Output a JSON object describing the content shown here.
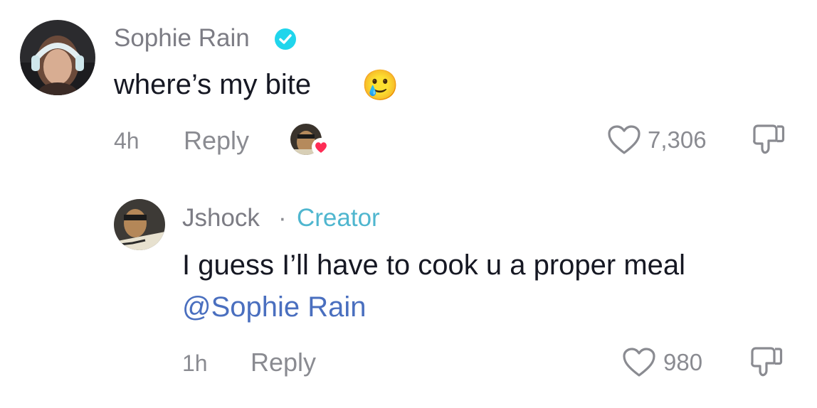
{
  "comments": [
    {
      "username": "Sophie Rain",
      "text": "where’s my bite",
      "emoji": "🥲",
      "time": "4h",
      "reply_label": "Reply",
      "like_count": "7,306"
    }
  ],
  "reply": {
    "username": "Jshock",
    "separator": "·",
    "badge": "Creator",
    "text": "I guess I’ll have to cook u a proper meal",
    "mention": "@Sophie Rain",
    "time": "1h",
    "reply_label": "Reply",
    "like_count": "980"
  },
  "colors": {
    "verified": "#20d5ec",
    "creator": "#4fb6cf",
    "mention": "#4a6fbf",
    "heart_badge": "#fe2c55"
  }
}
